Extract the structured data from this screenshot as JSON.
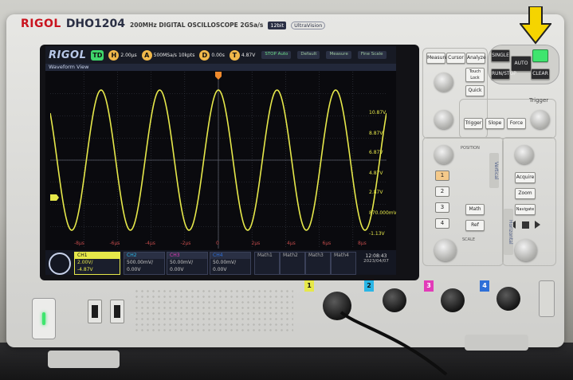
{
  "brand": {
    "logo": "RIGOL",
    "model": "DHO1204",
    "description": "200MHz DIGITAL OSCILLOSCOPE 2GSa/s",
    "bits": "12bit",
    "ultra": "UltraVision"
  },
  "screen": {
    "logo": "RIGOL",
    "run_mode": "TD",
    "h_label": "H",
    "timebase": "2.00µs",
    "a_label": "A",
    "sample_rate": "500MSa/s",
    "mem_depth": "10kpts",
    "d_label": "D",
    "delay": "0.00s",
    "t_label": "T",
    "trig_level": "4.87V",
    "stop_label": "STOP",
    "stop_sub": "Auto",
    "default_label": "Default",
    "measure_label": "Measure",
    "fine_label": "Fine Scale",
    "panel_title": "Waveform View",
    "voltage_labels": [
      "10.87V",
      "8.87V",
      "6.87V",
      "4.87V",
      "2.87V",
      "870.000mV",
      "-1.13V"
    ],
    "time_labels": [
      "-8µs",
      "-6µs",
      "-4µs",
      "-2µs",
      "0",
      "2µs",
      "4µs",
      "6µs",
      "8µs"
    ],
    "channels": [
      {
        "name": "CH1",
        "scale": "2.00V/",
        "offset": "-4.87V",
        "color": "#e6e84a"
      },
      {
        "name": "CH2",
        "scale": "500.00mV/",
        "offset": "0.00V",
        "color": "#2ab6e6"
      },
      {
        "name": "CH3",
        "scale": "50.00mV/",
        "offset": "0.00V",
        "color": "#e23bb8"
      },
      {
        "name": "CH4",
        "scale": "50.00mV/",
        "offset": "0.00V",
        "color": "#2e6fd8"
      }
    ],
    "maths": [
      "Math1",
      "Math2",
      "Math3",
      "Math4"
    ],
    "clock": {
      "time": "12:08:43",
      "date": "2023/04/07"
    }
  },
  "panel": {
    "measure": "Measure",
    "cursor": "Cursor",
    "analyze": "Analyze",
    "single": "SINGLE",
    "auto": "AUTO",
    "run_stop": "RUN/STOP",
    "clear": "CLEAR",
    "touch_lock": "Touch Lock",
    "quick": "Quick",
    "trigger_title": "Trigger",
    "trigger": "Trigger",
    "slope": "Slope",
    "force": "Force",
    "vertical": "Vertical",
    "horizontal": "Horizontal",
    "position": "POSITION",
    "scale": "SCALE",
    "acquire": "Acquire",
    "zoom": "Zoom",
    "navigate": "Navigate",
    "math": "Math",
    "ref": "Ref",
    "ch_buttons": [
      "1",
      "2",
      "3",
      "4"
    ]
  },
  "front": {
    "ch_tags": [
      "1",
      "2",
      "3",
      "4"
    ]
  },
  "colors": {
    "trace": "#e6e84a",
    "arrow": "#f5d400",
    "run_led": "#3fe56e"
  }
}
